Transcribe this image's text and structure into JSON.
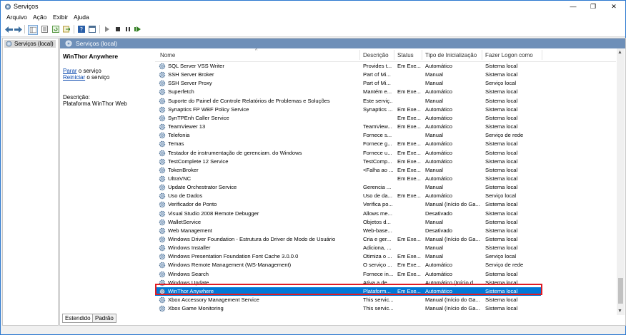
{
  "window": {
    "title": "Serviços",
    "controls": {
      "minimize": "—",
      "maximize": "❐",
      "close": "✕"
    }
  },
  "menu": [
    "Arquivo",
    "Ação",
    "Exibir",
    "Ajuda"
  ],
  "toolbar": {
    "icons": [
      "back-icon",
      "forward-icon",
      "show-hide-tree-icon",
      "properties-icon",
      "refresh-icon",
      "export-icon",
      "help-icon",
      "view-icon",
      "play-icon",
      "stop-icon",
      "pause-icon",
      "restart-icon"
    ]
  },
  "tree": {
    "root_label": "Serviços (local)"
  },
  "content": {
    "header_title": "Serviços (local)",
    "description": {
      "service_name": "WinThor Anywhere",
      "action_stop_link": "Parar",
      "action_stop_rest": " o serviço",
      "action_restart_link": "Reiniciar",
      "action_restart_rest": " o serviço",
      "desc_label": "Descrição:",
      "desc_value": "Plataforma WinThor Web"
    }
  },
  "table": {
    "columns": [
      "Nome",
      "Descrição",
      "Status",
      "Tipo de Inicialização",
      "Fazer Logon como"
    ],
    "sort_indicator": "^",
    "rows": [
      {
        "name": "SQL Server VSS Writer",
        "desc": "Provides t...",
        "status": "Em Exe...",
        "startup": "Automático",
        "logon": "Sistema local"
      },
      {
        "name": "SSH Server Broker",
        "desc": "Part of Mi...",
        "status": "",
        "startup": "Manual",
        "logon": "Sistema local"
      },
      {
        "name": "SSH Server Proxy",
        "desc": "Part of Mi...",
        "status": "",
        "startup": "Manual",
        "logon": "Serviço local"
      },
      {
        "name": "Superfetch",
        "desc": "Mantém e...",
        "status": "Em Exe...",
        "startup": "Automático",
        "logon": "Sistema local"
      },
      {
        "name": "Suporte do Painel de Controle Relatórios de Problemas e Soluções",
        "desc": "Este serviç...",
        "status": "",
        "startup": "Manual",
        "logon": "Sistema local"
      },
      {
        "name": "Synaptics FP WBF Policy Service",
        "desc": "Synaptics ...",
        "status": "Em Exe...",
        "startup": "Automático",
        "logon": "Sistema local"
      },
      {
        "name": "SynTPEnh Caller Service",
        "desc": "",
        "status": "Em Exe...",
        "startup": "Automático",
        "logon": "Sistema local"
      },
      {
        "name": "TeamViewer 13",
        "desc": "TeamView...",
        "status": "Em Exe...",
        "startup": "Automático",
        "logon": "Sistema local"
      },
      {
        "name": "Telefonia",
        "desc": "Fornece s...",
        "status": "",
        "startup": "Manual",
        "logon": "Serviço de rede"
      },
      {
        "name": "Temas",
        "desc": "Fornece g...",
        "status": "Em Exe...",
        "startup": "Automático",
        "logon": "Sistema local"
      },
      {
        "name": "Testador de instrumentação de gerenciam. do Windows",
        "desc": "Fornece u...",
        "status": "Em Exe...",
        "startup": "Automático",
        "logon": "Sistema local"
      },
      {
        "name": "TestComplete 12 Service",
        "desc": "TestComp...",
        "status": "Em Exe...",
        "startup": "Automático",
        "logon": "Sistema local"
      },
      {
        "name": "TokenBroker",
        "desc": "<Falha ao ...",
        "status": "Em Exe...",
        "startup": "Manual",
        "logon": "Sistema local"
      },
      {
        "name": "UltraVNC",
        "desc": "",
        "status": "Em Exe...",
        "startup": "Automático",
        "logon": "Sistema local"
      },
      {
        "name": "Update Orchestrator Service",
        "desc": "Gerencia ...",
        "status": "",
        "startup": "Manual",
        "logon": "Sistema local"
      },
      {
        "name": "Uso de Dados",
        "desc": "Uso de da...",
        "status": "Em Exe...",
        "startup": "Automático",
        "logon": "Serviço local"
      },
      {
        "name": "Verificador de Ponto",
        "desc": "Verifica po...",
        "status": "",
        "startup": "Manual (Início do Ga...",
        "logon": "Sistema local"
      },
      {
        "name": "Visual Studio 2008 Remote Debugger",
        "desc": "Allows me...",
        "status": "",
        "startup": "Desativado",
        "logon": "Sistema local"
      },
      {
        "name": "WalletService",
        "desc": "Objetos d...",
        "status": "",
        "startup": "Manual",
        "logon": "Sistema local"
      },
      {
        "name": "Web Management",
        "desc": "Web-base...",
        "status": "",
        "startup": "Desativado",
        "logon": "Sistema local"
      },
      {
        "name": "Windows Driver Foundation - Estrutura do Driver de Modo de Usuário",
        "desc": "Cria e ger...",
        "status": "Em Exe...",
        "startup": "Manual (Início do Ga...",
        "logon": "Sistema local"
      },
      {
        "name": "Windows Installer",
        "desc": "Adiciona, ...",
        "status": "",
        "startup": "Manual",
        "logon": "Sistema local"
      },
      {
        "name": "Windows Presentation Foundation Font Cache 3.0.0.0",
        "desc": "Otimiza o ...",
        "status": "Em Exe...",
        "startup": "Manual",
        "logon": "Serviço local"
      },
      {
        "name": "Windows Remote Management (WS-Management)",
        "desc": "O serviço ...",
        "status": "Em Exe...",
        "startup": "Automático",
        "logon": "Serviço de rede"
      },
      {
        "name": "Windows Search",
        "desc": "Fornece in...",
        "status": "Em Exe...",
        "startup": "Automático",
        "logon": "Sistema local"
      },
      {
        "name": "Windows Update",
        "desc": "Ativa a de...",
        "status": "",
        "startup": "Automático (Início d...",
        "logon": "Sistema local"
      },
      {
        "name": "WinThor Anywhere",
        "desc": "Plataform...",
        "status": "Em Exe...",
        "startup": "Automático",
        "logon": "Sistema local",
        "selected": true
      },
      {
        "name": "Xbox Accessory Management Service",
        "desc": "This servic...",
        "status": "",
        "startup": "Manual (Início do Ga...",
        "logon": "Sistema local"
      },
      {
        "name": "Xbox Game Monitoring",
        "desc": "This servic...",
        "status": "",
        "startup": "Manual (Início do Ga...",
        "logon": "Sistema local"
      }
    ]
  },
  "tabs": [
    "Estendido",
    "Padrão"
  ],
  "colors": {
    "selection": "#0078d7",
    "highlight_border": "#e01b24",
    "pane_header": "#6e8fb8",
    "link": "#0645ad"
  }
}
